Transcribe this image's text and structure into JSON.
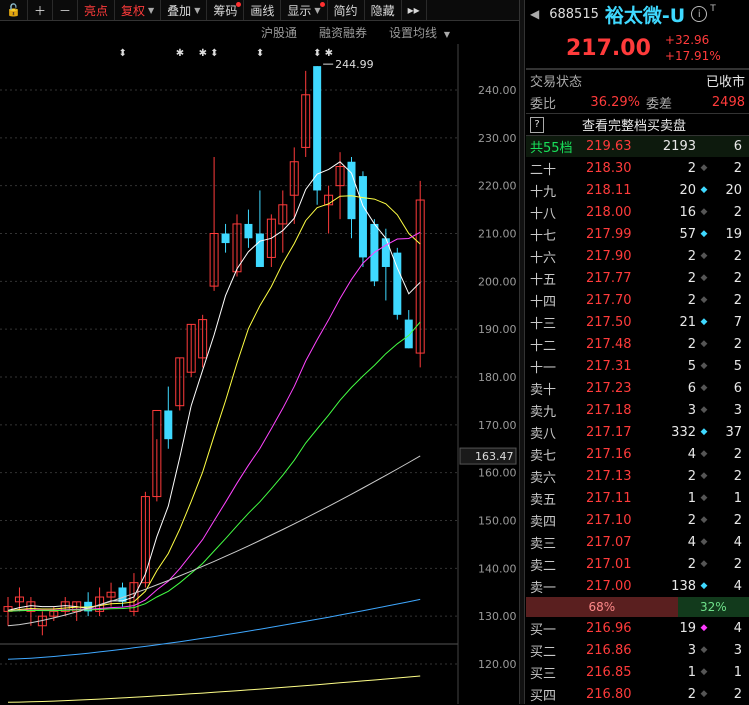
{
  "toolbar": {
    "items": [
      "亮点",
      "复权",
      "叠加",
      "筹码",
      "画线",
      "显示",
      "简约",
      "隐藏"
    ],
    "expand": "▸▸"
  },
  "subbar": [
    "沪股通",
    "融资融券",
    "设置均线"
  ],
  "chart_data": {
    "type": "candlestick",
    "ylim": [
      115,
      250
    ],
    "yticks": [
      120,
      130,
      140,
      150,
      160,
      170,
      180,
      190,
      200,
      210,
      220,
      230,
      240
    ],
    "ytick_labels": [
      "120.00",
      "130.00",
      "140.00",
      "150.00",
      "160.00",
      "170.00",
      "180.00",
      "190.00",
      "200.00",
      "210.00",
      "220.00",
      "230.00",
      "240.00"
    ],
    "current_marker": "163.47",
    "high_annotation": "244.99",
    "candles": [
      {
        "o": 131,
        "h": 134,
        "l": 128,
        "c": 132
      },
      {
        "o": 133,
        "h": 136,
        "l": 131,
        "c": 134
      },
      {
        "o": 131,
        "h": 134,
        "l": 128,
        "c": 133
      },
      {
        "o": 128,
        "h": 131,
        "l": 126,
        "c": 130
      },
      {
        "o": 130,
        "h": 132,
        "l": 129,
        "c": 131
      },
      {
        "o": 131,
        "h": 134,
        "l": 130,
        "c": 133
      },
      {
        "o": 131,
        "h": 133,
        "l": 129,
        "c": 133
      },
      {
        "o": 133,
        "h": 135,
        "l": 130,
        "c": 131
      },
      {
        "o": 131,
        "h": 136,
        "l": 130,
        "c": 134
      },
      {
        "o": 134,
        "h": 137,
        "l": 132,
        "c": 135
      },
      {
        "o": 136,
        "h": 137,
        "l": 132,
        "c": 133
      },
      {
        "o": 131,
        "h": 139,
        "l": 130,
        "c": 137
      },
      {
        "o": 137,
        "h": 156,
        "l": 136,
        "c": 155
      },
      {
        "o": 155,
        "h": 167,
        "l": 154,
        "c": 173
      },
      {
        "o": 173,
        "h": 178,
        "l": 165,
        "c": 167
      },
      {
        "o": 174,
        "h": 184,
        "l": 173,
        "c": 184
      },
      {
        "o": 181,
        "h": 191,
        "l": 180,
        "c": 191
      },
      {
        "o": 184,
        "h": 193,
        "l": 182,
        "c": 192
      },
      {
        "o": 199,
        "h": 226,
        "l": 198,
        "c": 210
      },
      {
        "o": 210,
        "h": 212,
        "l": 206,
        "c": 208
      },
      {
        "o": 202,
        "h": 214,
        "l": 201,
        "c": 212
      },
      {
        "o": 212,
        "h": 215,
        "l": 207,
        "c": 209
      },
      {
        "o": 210,
        "h": 219,
        "l": 204,
        "c": 203
      },
      {
        "o": 205,
        "h": 214,
        "l": 203,
        "c": 213
      },
      {
        "o": 212,
        "h": 219,
        "l": 206,
        "c": 216
      },
      {
        "o": 218,
        "h": 228,
        "l": 212,
        "c": 225
      },
      {
        "o": 228,
        "h": 244,
        "l": 226,
        "c": 239
      },
      {
        "o": 244.99,
        "h": 244.99,
        "l": 216,
        "c": 219
      },
      {
        "o": 216,
        "h": 220,
        "l": 210,
        "c": 218
      },
      {
        "o": 220,
        "h": 227,
        "l": 213,
        "c": 224
      },
      {
        "o": 225,
        "h": 226,
        "l": 209,
        "c": 213
      },
      {
        "o": 222,
        "h": 223,
        "l": 203,
        "c": 205
      },
      {
        "o": 212,
        "h": 213,
        "l": 199,
        "c": 200
      },
      {
        "o": 209,
        "h": 211,
        "l": 196,
        "c": 203
      },
      {
        "o": 206,
        "h": 207,
        "l": 192,
        "c": 193
      },
      {
        "o": 192,
        "h": 194,
        "l": 186,
        "c": 186
      },
      {
        "o": 185,
        "h": 221,
        "l": 182,
        "c": 217
      }
    ],
    "series": [
      {
        "color": "#ffffff"
      },
      {
        "color": "#ffff44"
      },
      {
        "color": "#ff44ff"
      },
      {
        "color": "#44ff44"
      },
      {
        "color": "#cccccc"
      },
      {
        "color": "#3fa8ff"
      },
      {
        "color": "#ffff88"
      }
    ]
  },
  "panel": {
    "code": "688515",
    "name": "裕太微-U",
    "sup": "T",
    "price": "217.00",
    "change": "+32.96",
    "pct": "+17.91%",
    "status_label": "交易状态",
    "status_value": "已收市",
    "weibi_label": "委比",
    "weibi_value": "36.29%",
    "weicha_label": "委差",
    "weicha_value": "2498",
    "full_levels_btn": "查看完整档买卖盘",
    "top_row": {
      "lbl": "共55档",
      "price": "219.63",
      "vol": "2193",
      "v2": "6"
    },
    "sell_rows": [
      {
        "lbl": "二十",
        "price": "218.30",
        "vol": "2",
        "mk": "gray",
        "v2": "2"
      },
      {
        "lbl": "十九",
        "price": "218.11",
        "vol": "20",
        "mk": "cyan",
        "v2": "20"
      },
      {
        "lbl": "十八",
        "price": "218.00",
        "vol": "16",
        "mk": "gray",
        "v2": "2"
      },
      {
        "lbl": "十七",
        "price": "217.99",
        "vol": "57",
        "mk": "cyan",
        "v2": "19"
      },
      {
        "lbl": "十六",
        "price": "217.90",
        "vol": "2",
        "mk": "gray",
        "v2": "2"
      },
      {
        "lbl": "十五",
        "price": "217.77",
        "vol": "2",
        "mk": "gray",
        "v2": "2"
      },
      {
        "lbl": "十四",
        "price": "217.70",
        "vol": "2",
        "mk": "gray",
        "v2": "2"
      },
      {
        "lbl": "十三",
        "price": "217.50",
        "vol": "21",
        "mk": "cyan",
        "v2": "7"
      },
      {
        "lbl": "十二",
        "price": "217.48",
        "vol": "2",
        "mk": "gray",
        "v2": "2"
      },
      {
        "lbl": "十一",
        "price": "217.31",
        "vol": "5",
        "mk": "gray",
        "v2": "5"
      },
      {
        "lbl": "卖十",
        "price": "217.23",
        "vol": "6",
        "mk": "gray",
        "v2": "6"
      },
      {
        "lbl": "卖九",
        "price": "217.18",
        "vol": "3",
        "mk": "gray",
        "v2": "3"
      },
      {
        "lbl": "卖八",
        "price": "217.17",
        "vol": "332",
        "mk": "cyan",
        "v2": "37"
      },
      {
        "lbl": "卖七",
        "price": "217.16",
        "vol": "4",
        "mk": "gray",
        "v2": "2"
      },
      {
        "lbl": "卖六",
        "price": "217.13",
        "vol": "2",
        "mk": "gray",
        "v2": "2"
      },
      {
        "lbl": "卖五",
        "price": "217.11",
        "vol": "1",
        "mk": "gray",
        "v2": "1"
      },
      {
        "lbl": "卖四",
        "price": "217.10",
        "vol": "2",
        "mk": "gray",
        "v2": "2"
      },
      {
        "lbl": "卖三",
        "price": "217.07",
        "vol": "4",
        "mk": "gray",
        "v2": "4"
      },
      {
        "lbl": "卖二",
        "price": "217.01",
        "vol": "2",
        "mk": "gray",
        "v2": "2"
      },
      {
        "lbl": "卖一",
        "price": "217.00",
        "vol": "138",
        "mk": "cyan",
        "v2": "4"
      }
    ],
    "ratio_sell": "68%",
    "ratio_sell_frac": 0.68,
    "ratio_buy": "32%",
    "buy_rows": [
      {
        "lbl": "买一",
        "price": "216.96",
        "vol": "19",
        "mk": "mag",
        "v2": "4"
      },
      {
        "lbl": "买二",
        "price": "216.86",
        "vol": "3",
        "mk": "gray",
        "v2": "3"
      },
      {
        "lbl": "买三",
        "price": "216.85",
        "vol": "1",
        "mk": "gray",
        "v2": "1"
      },
      {
        "lbl": "买四",
        "price": "216.80",
        "vol": "2",
        "mk": "gray",
        "v2": "2"
      }
    ]
  }
}
